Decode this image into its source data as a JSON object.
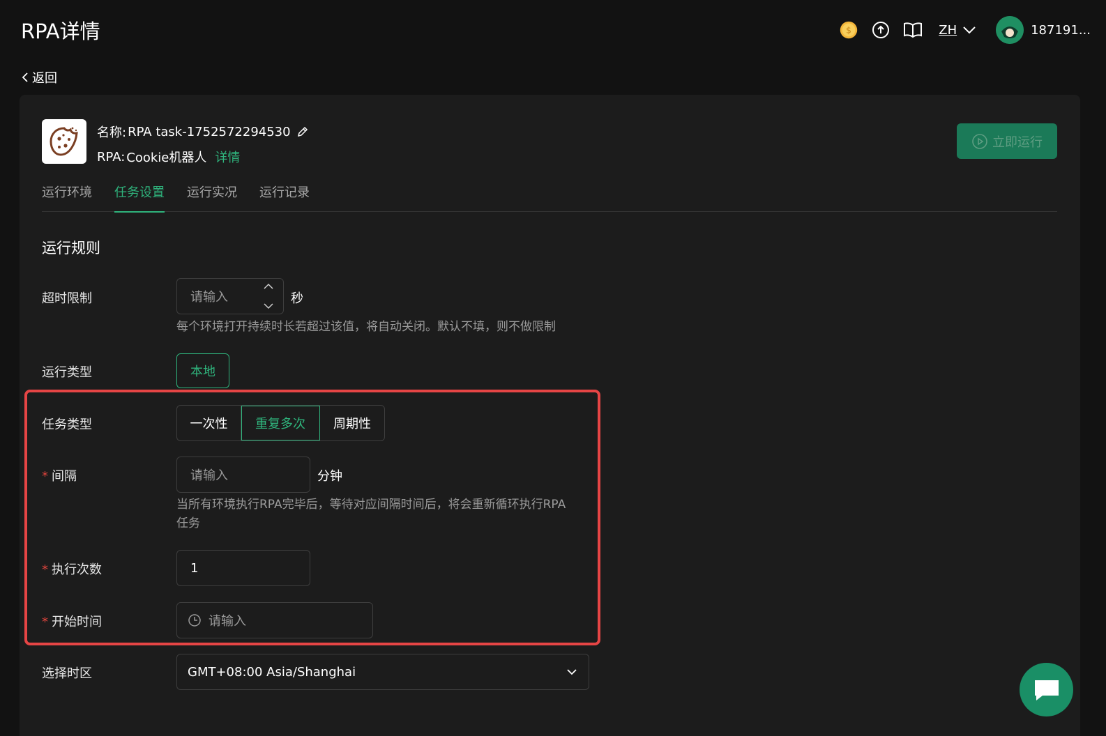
{
  "app": {
    "title": "RPA详情"
  },
  "topbar": {
    "icons": [
      "coin-icon",
      "upload-icon",
      "book-icon"
    ],
    "language": "ZH",
    "username": "187191..."
  },
  "nav": {
    "back_label": "返回"
  },
  "task": {
    "name_label": "名称:",
    "name_value": "RPA task-1752572294530",
    "rpa_label": "RPA:",
    "rpa_value": "Cookie机器人",
    "detail_link": "详情",
    "run_button": "立即运行"
  },
  "tabs": [
    {
      "label": "运行环境",
      "active": false
    },
    {
      "label": "任务设置",
      "active": true
    },
    {
      "label": "运行实况",
      "active": false
    },
    {
      "label": "运行记录",
      "active": false
    }
  ],
  "form": {
    "section_title": "运行规则",
    "timeout": {
      "label": "超时限制",
      "placeholder": "请输入",
      "unit": "秒",
      "hint": "每个环境打开持续时长若超过该值，将自动关闭。默认不填，则不做限制"
    },
    "run_type": {
      "label": "运行类型",
      "value": "本地"
    },
    "task_type": {
      "label": "任务类型",
      "options": [
        "一次性",
        "重复多次",
        "周期性"
      ],
      "selected": "重复多次"
    },
    "interval": {
      "required_mark": "*",
      "label": "间隔",
      "placeholder": "请输入",
      "unit": "分钟",
      "hint_line1": "当所有环境执行RPA完毕后，等待对应间隔时间后，将会重新循环执行RPA",
      "hint_line2": "任务"
    },
    "exec_count": {
      "required_mark": "*",
      "label": "执行次数",
      "value": "1"
    },
    "start_time": {
      "required_mark": "*",
      "label": "开始时间",
      "placeholder": "请输入"
    },
    "timezone": {
      "label": "选择时区",
      "value": "GMT+08:00 Asia/Shanghai"
    }
  },
  "colors": {
    "accent": "#2fb37c",
    "highlight": "#e64545",
    "background": "#121212",
    "panel": "#1c1c1c"
  }
}
